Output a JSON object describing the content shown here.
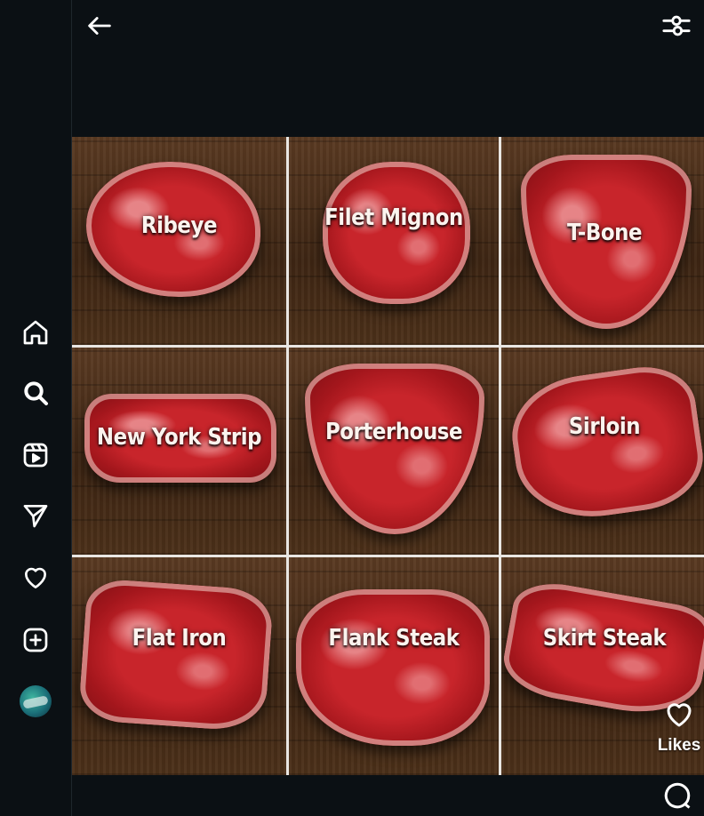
{
  "sidebar": {
    "items": [
      {
        "name": "home",
        "icon": "home-icon"
      },
      {
        "name": "search",
        "icon": "search-icon"
      },
      {
        "name": "reels",
        "icon": "reels-icon"
      },
      {
        "name": "messages",
        "icon": "send-icon"
      },
      {
        "name": "notifications",
        "icon": "heart-icon"
      },
      {
        "name": "create",
        "icon": "plus-square-icon"
      },
      {
        "name": "profile",
        "icon": "avatar"
      }
    ]
  },
  "topbar": {
    "back_icon": "arrow-left-icon",
    "filter_icon": "sliders-icon"
  },
  "post": {
    "grid_labels": [
      "Ribeye",
      "Filet Mignon",
      "T-Bone",
      "New York Strip",
      "Porterhouse",
      "Sirloin",
      "Flat Iron",
      "Flank Steak",
      "Skirt Steak"
    ]
  },
  "actions": {
    "likes_label": "Likes",
    "like_icon": "heart-outline-icon",
    "comment_icon": "comment-icon"
  },
  "colors": {
    "background": "#0b1014",
    "meat_red": "#c8252b",
    "wood": "#4c3019"
  }
}
